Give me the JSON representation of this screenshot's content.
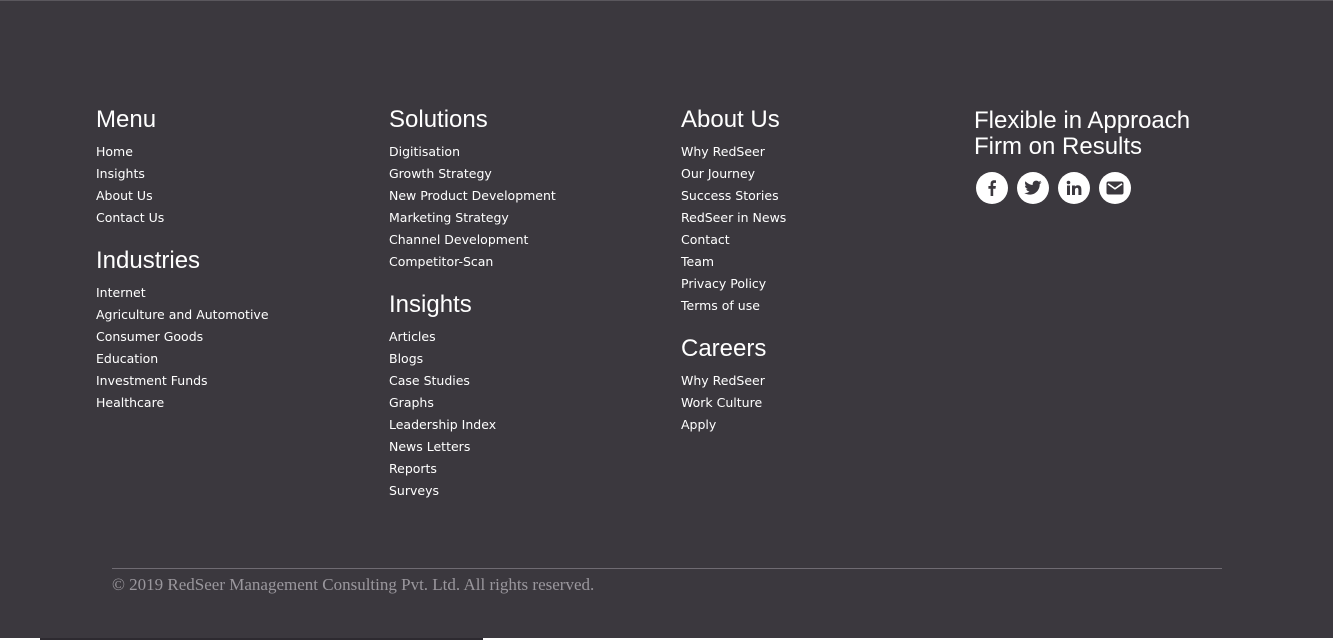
{
  "menu": {
    "heading": "Menu",
    "items": [
      "Home",
      "Insights",
      "About Us",
      "Contact Us"
    ]
  },
  "industries": {
    "heading": "Industries",
    "items": [
      "Internet",
      "Agriculture and Automotive",
      "Consumer Goods",
      "Education",
      "Investment Funds",
      "Healthcare"
    ]
  },
  "solutions": {
    "heading": "Solutions",
    "items": [
      "Digitisation",
      "Growth Strategy",
      "New Product Development",
      "Marketing Strategy",
      "Channel Development",
      "Competitor-Scan"
    ]
  },
  "insights": {
    "heading": "Insights",
    "items": [
      "Articles",
      "Blogs",
      "Case Studies",
      "Graphs",
      "Leadership Index",
      "News Letters",
      "Reports",
      "Surveys"
    ]
  },
  "about": {
    "heading": "About Us",
    "items": [
      "Why RedSeer",
      "Our Journey",
      "Success Stories",
      "RedSeer in News",
      "Contact",
      "Team",
      "Privacy Policy",
      "Terms of use"
    ]
  },
  "careers": {
    "heading": "Careers",
    "items": [
      "Why RedSeer",
      "Work Culture",
      "Apply"
    ]
  },
  "tagline": {
    "line1": "Flexible in Approach",
    "line2": "Firm on Results"
  },
  "social": {
    "icons": [
      "facebook-icon",
      "twitter-icon",
      "linkedin-icon",
      "email-icon"
    ]
  },
  "footer": {
    "copyright": "© 2019 RedSeer Management Consulting Pvt. Ltd. All rights reserved."
  },
  "colors": {
    "background": "#3b383e",
    "text": "#ffffff",
    "muted": "#9a979d"
  }
}
